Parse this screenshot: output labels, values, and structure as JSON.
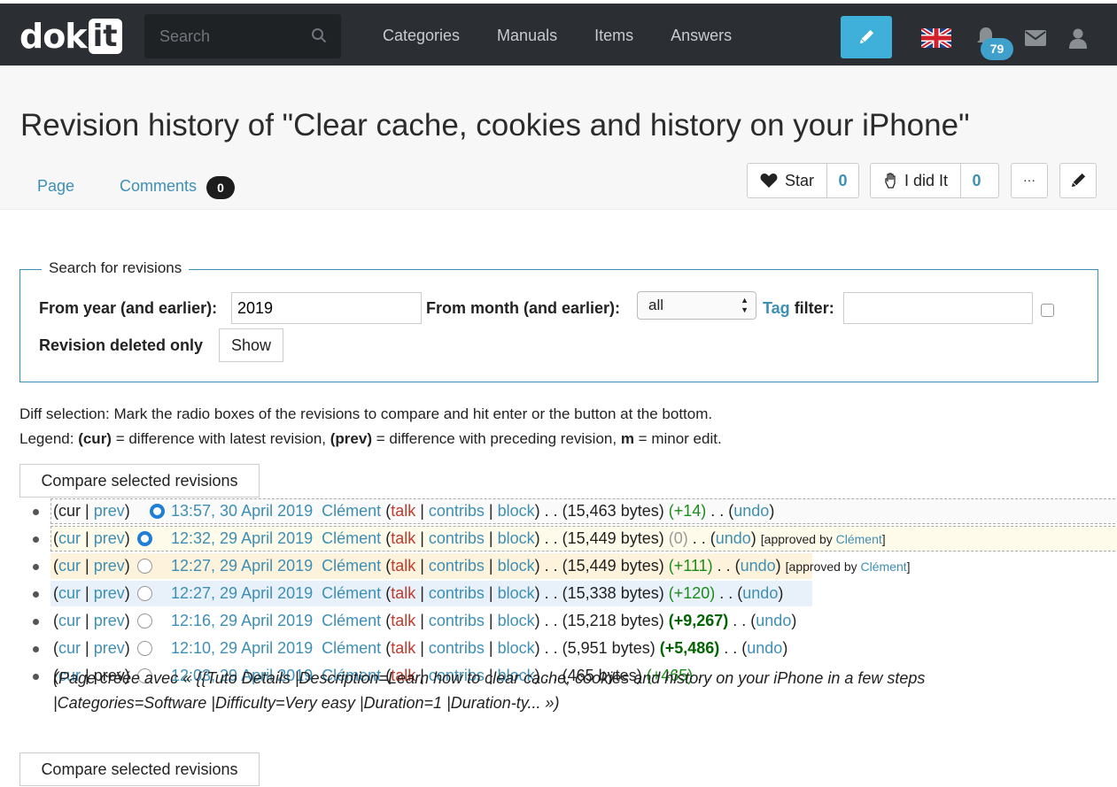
{
  "nav": {
    "logo_main": "dok",
    "logo_box": "it",
    "search_placeholder": "Search",
    "links": [
      "Categories",
      "Manuals",
      "Items",
      "Answers"
    ],
    "notification_count": "79"
  },
  "page": {
    "title": "Revision history of \"Clear cache, cookies and history on your iPhone\"",
    "tab_page": "Page",
    "tab_comments": "Comments",
    "comments_count": "0",
    "star_label": "Star",
    "star_count": "0",
    "didit_label": "I did It",
    "didit_count": "0",
    "more_label": "···"
  },
  "search_form": {
    "legend": "Search for revisions",
    "year_label": "From year (and earlier):",
    "year_value": "2019",
    "month_label": "From month (and earlier):",
    "month_value": "all",
    "tag_link": "Tag",
    "tag_label": "filter:",
    "tag_value": "",
    "deleted_label": "Revision deleted only",
    "show_button": "Show"
  },
  "instructions": {
    "line1": "Diff selection: Mark the radio boxes of the revisions to compare and hit enter or the button at the bottom.",
    "legend_prefix": "Legend: ",
    "cur": "(cur)",
    "cur_desc": " = difference with latest revision, ",
    "prev": "(prev)",
    "prev_desc": " = difference with preceding revision, ",
    "m": "m",
    "m_desc": " = minor edit."
  },
  "compare_button": "Compare selected revisions",
  "revisions": [
    {
      "date": "13:57, 30 April 2019",
      "user": "Clément",
      "bytes": "(15,463 bytes)",
      "diff": "(+14)",
      "approved": ""
    },
    {
      "date": "12:32, 29 April 2019",
      "user": "Clément",
      "bytes": "(15,449 bytes)",
      "diff": "(0)",
      "approved": "[approved by Clément]"
    },
    {
      "date": "12:27, 29 April 2019",
      "user": "Clément",
      "bytes": "(15,449 bytes)",
      "diff": "(+111)",
      "approved": "[approved by Clément]"
    },
    {
      "date": "12:27, 29 April 2019",
      "user": "Clément",
      "bytes": "(15,338 bytes)",
      "diff": "(+120)",
      "approved": ""
    },
    {
      "date": "12:16, 29 April 2019",
      "user": "Clément",
      "bytes": "(15,218 bytes)",
      "diff": "(+9,267)",
      "approved": ""
    },
    {
      "date": "12:10, 29 April 2019",
      "user": "Clément",
      "bytes": "(5,951 bytes)",
      "diff": "(+5,486)",
      "approved": ""
    },
    {
      "date": "12:03, 29 April 2019",
      "user": "Clément",
      "bytes": "(465 bytes)",
      "diff": "(+465)",
      "approved": ""
    }
  ],
  "rev_words": {
    "cur": "cur",
    "prev": "prev",
    "talk": "talk",
    "contribs": "contribs",
    "block": "block",
    "undo": "undo",
    "approved_by": "[approved by ",
    "approved_user": "Clément"
  },
  "first_summary": "(Page créée avec « {{Tuto Details |Description=Learn how to clear cache, cookies and history on your iPhone in a few steps |Categories=Software |Difficulty=Very easy |Duration=1 |Duration-ty... »)",
  "colors": {
    "topbar": "#2b2f33",
    "accent": "#3fb0d9",
    "link": "#3d8fb5",
    "talk": "#c0392b",
    "added": "#1a8c1a"
  }
}
